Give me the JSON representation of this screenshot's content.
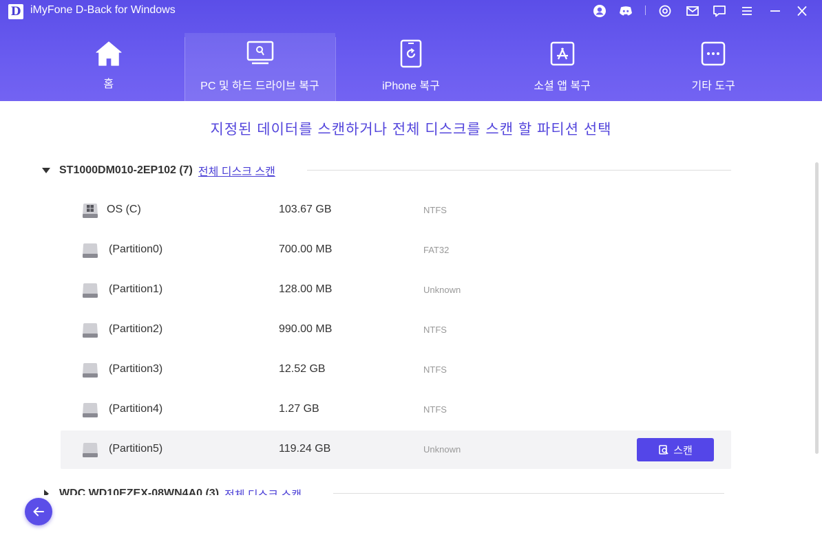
{
  "app": {
    "logo_letter": "D",
    "title": "iMyFone D-Back for Windows",
    "accent_color": "#5446e8"
  },
  "nav": {
    "tabs": [
      {
        "label": "홈",
        "icon": "home-icon",
        "active": false
      },
      {
        "label": "PC 및 하드 드라이브 복구",
        "icon": "pc-recovery-icon",
        "active": true
      },
      {
        "label": "iPhone 복구",
        "icon": "iphone-icon",
        "active": false
      },
      {
        "label": "소셜 앱 복구",
        "icon": "app-store-icon",
        "active": false
      },
      {
        "label": "기타 도구",
        "icon": "more-tools-icon",
        "active": false
      }
    ]
  },
  "main": {
    "instruction": "지정된 데이터를 스캔하거나 전체 디스크를 스캔 할 파티션 선택",
    "disks": [
      {
        "name": "ST1000DM010-2EP102 (7)",
        "scan_all_label": "전체 디스크 스캔",
        "partitions": [
          {
            "name": "OS (C)",
            "size": "103.67 GB",
            "fs": "NTFS",
            "icon": "windows-drive-icon"
          },
          {
            "name": "(Partition0)",
            "size": "700.00 MB",
            "fs": "FAT32",
            "icon": "drive-icon"
          },
          {
            "name": "(Partition1)",
            "size": "128.00 MB",
            "fs": "Unknown",
            "icon": "drive-icon"
          },
          {
            "name": "(Partition2)",
            "size": "990.00 MB",
            "fs": "NTFS",
            "icon": "drive-icon"
          },
          {
            "name": "(Partition3)",
            "size": "12.52 GB",
            "fs": "NTFS",
            "icon": "drive-icon"
          },
          {
            "name": "(Partition4)",
            "size": "1.27 GB",
            "fs": "NTFS",
            "icon": "drive-icon"
          },
          {
            "name": "(Partition5)",
            "size": "119.24 GB",
            "fs": "Unknown",
            "icon": "drive-icon"
          }
        ],
        "scan_button_label": "스캔"
      },
      {
        "name": "WDC WD10EZEX-08WN4A0 (3)",
        "scan_all_label": "전체 디스크 스캔"
      }
    ]
  }
}
